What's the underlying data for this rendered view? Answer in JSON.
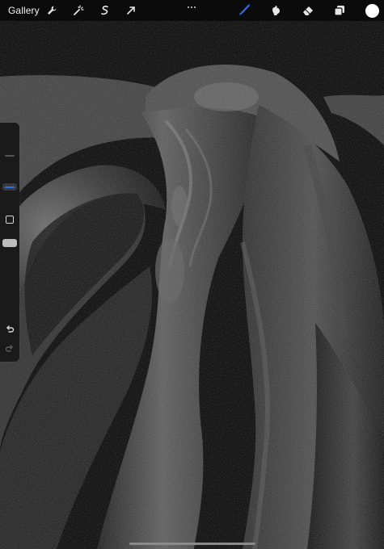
{
  "topbar": {
    "gallery_label": "Gallery",
    "left_tools": [
      "wrench-icon",
      "magic-wand-icon",
      "selection-icon",
      "transform-arrow-icon"
    ],
    "right_tools": [
      "brush-icon",
      "smudge-icon",
      "eraser-icon",
      "layers-icon",
      "color-swatch"
    ],
    "active_tool": "brush-icon",
    "accent_color": "#2d6cf0",
    "current_color": "#ffffff"
  },
  "sidebar": {
    "brush_size_level": 0.2,
    "opacity_level": 0.05,
    "tools": [
      "modify-button",
      "undo-icon",
      "redo-icon"
    ]
  }
}
